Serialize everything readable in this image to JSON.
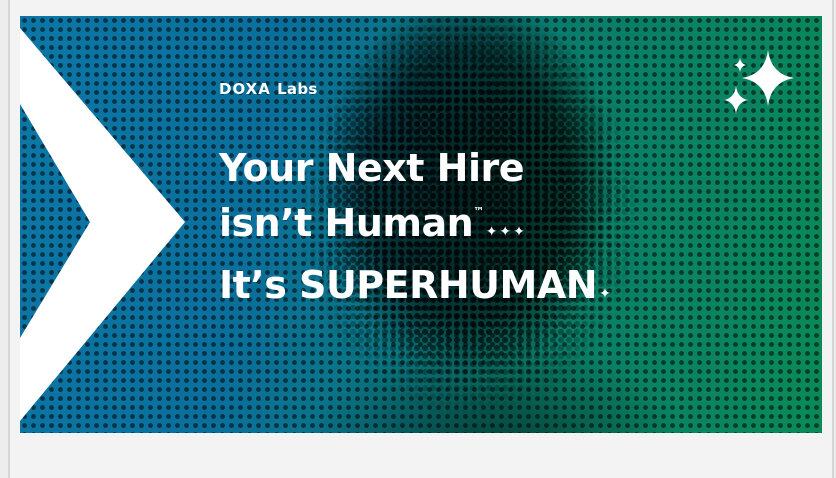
{
  "banner": {
    "logo_brand": "DOXA",
    "logo_suffix": "Labs",
    "headline_line1": "Your Next Hire",
    "headline_line2": "isn’t Human",
    "headline_line2_tm": "™",
    "headline_line2_sparkles": "✦✦✦",
    "headline_line3": "It’s SUPERHUMAN",
    "headline_line3_sparkle": "✦"
  },
  "colors": {
    "gradient_left": "#0c77a6",
    "gradient_right": "#0a8a58",
    "text": "#ffffff"
  },
  "icons": {
    "corner": "sparkles-icon",
    "left": "chevron-arrow-icon"
  }
}
